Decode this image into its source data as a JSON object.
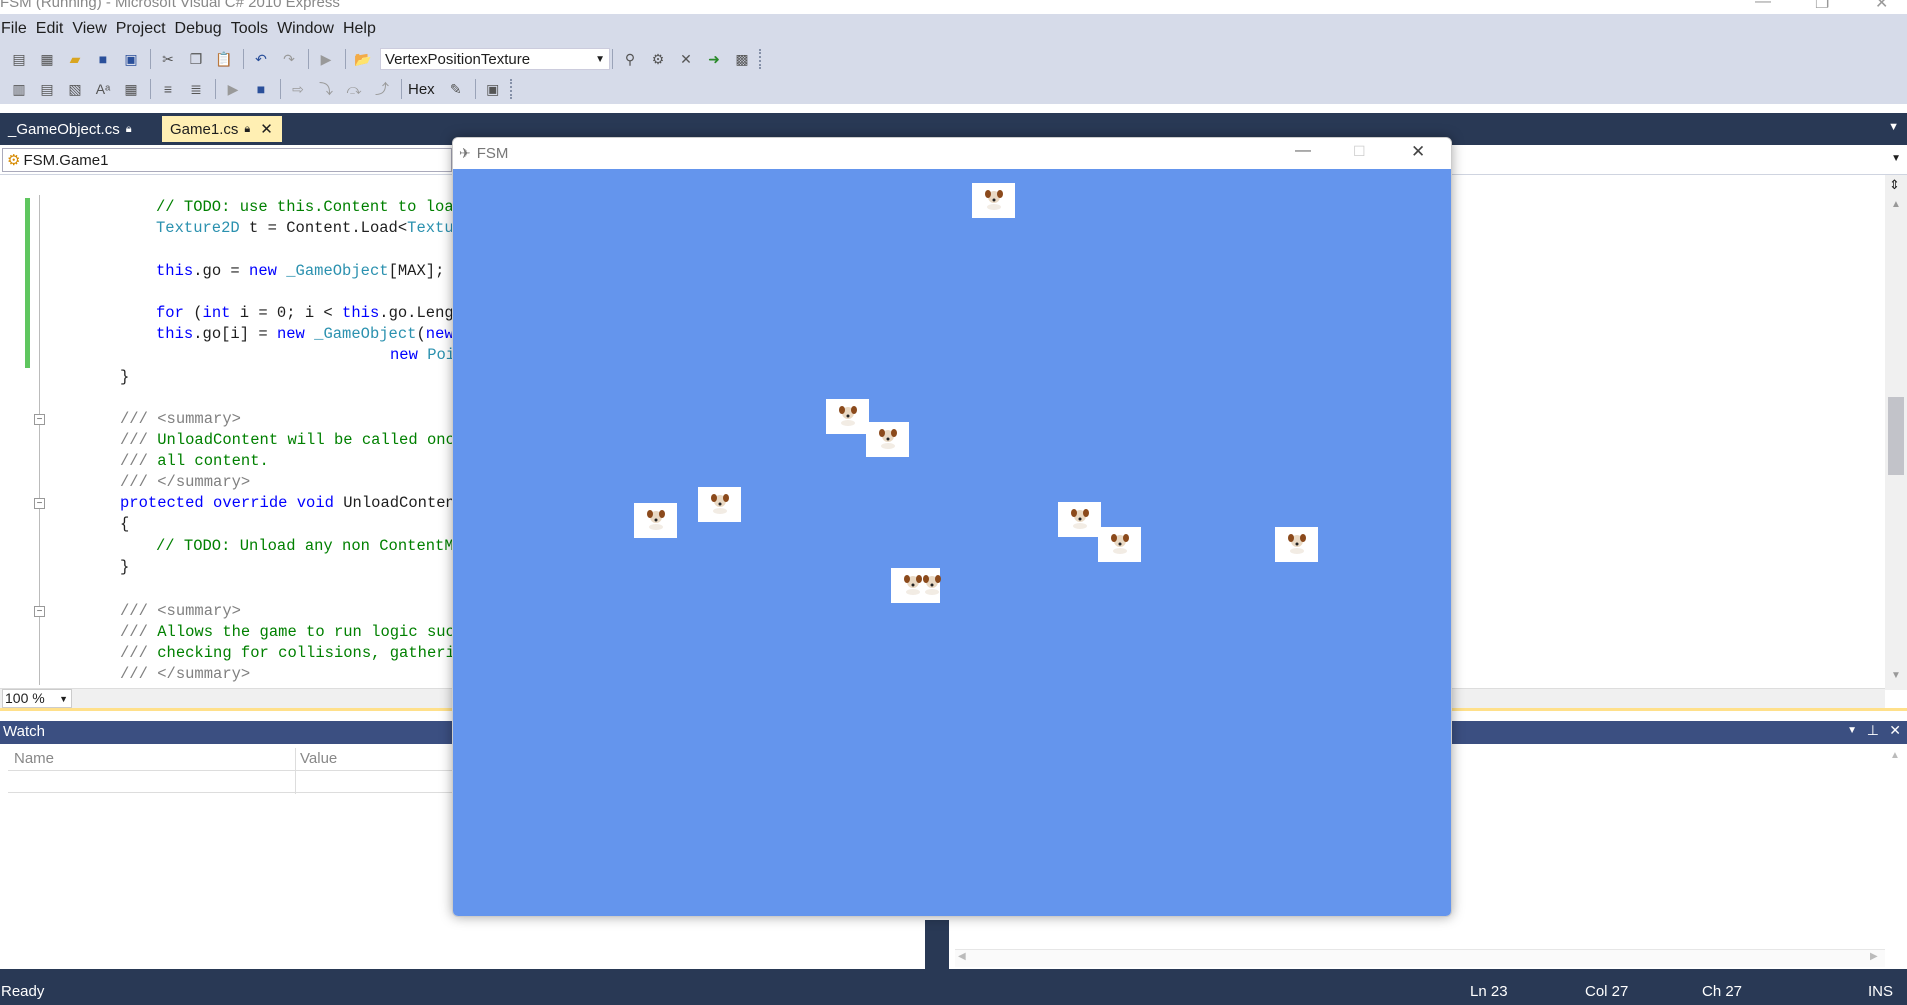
{
  "window": {
    "title": "FSM (Running) - Microsoft Visual C# 2010 Express"
  },
  "menu": [
    "File",
    "Edit",
    "View",
    "Project",
    "Debug",
    "Tools",
    "Window",
    "Help"
  ],
  "toolbar": {
    "config_value": "VertexPositionTexture",
    "hex_label": "Hex"
  },
  "tabs": [
    {
      "label": "_GameObject.cs"
    },
    {
      "label": "Game1.cs"
    }
  ],
  "nav": {
    "class_value": "FSM.Game1"
  },
  "code": {
    "l1": "// TODO: use this.Content to load",
    "l2_type": "Texture2D",
    "l2_rest": " t = Content.Load<",
    "l2_type2": "Textur",
    "l3_kw": "this",
    "l3_a": ".go = ",
    "l3_new": "new",
    "l3_type": " _GameObject",
    "l3_b": "[MAX];",
    "l4_for": "for",
    "l4_a": " (",
    "l4_int": "int",
    "l4_b": " i = 0; i < ",
    "l4_this": "this",
    "l4_c": ".go.Lengt",
    "l5_this": "this",
    "l5_a": ".go[i] = ",
    "l5_new": "new",
    "l5_type": " _GameObject",
    "l5_b": "(",
    "l5_new2": "new",
    "l6_new": "new",
    "l6_type": " Poi",
    "l7": "}",
    "l8_a": "/// ",
    "l8_b": "<summary>",
    "l9_a": "/// ",
    "l9_b": "UnloadContent will be called once",
    "l10_a": "/// ",
    "l10_b": "all content.",
    "l11_a": "/// ",
    "l11_b": "</summary>",
    "l12_kw": "protected override void",
    "l12_b": " UnloadContent",
    "l13": "{",
    "l14": "// TODO: Unload any non ContentMa",
    "l15": "}",
    "l16_a": "/// ",
    "l16_b": "<summary>",
    "l17_a": "/// ",
    "l17_b": "Allows the game to run logic such",
    "l18_a": "/// ",
    "l18_b": "checking for collisions, gatherin",
    "l19_a": "/// ",
    "l19_b": "</summary>"
  },
  "zoom": "100 %",
  "watch": {
    "title": "Watch",
    "col_name": "Name",
    "col_value": "Value"
  },
  "status": {
    "ready": "Ready",
    "ln": "Ln 23",
    "col": "Col 27",
    "ch": "Ch 27",
    "ins": "INS"
  },
  "fsm": {
    "title": "FSM",
    "background": "#6495ED",
    "sprite_count": 10
  },
  "colors": {
    "menu_bg": "#D6DBE9",
    "doc_bar": "#293955",
    "active_tab": "#FFEFB3",
    "watch_header": "#3B4F81",
    "status_bg": "#293955"
  }
}
